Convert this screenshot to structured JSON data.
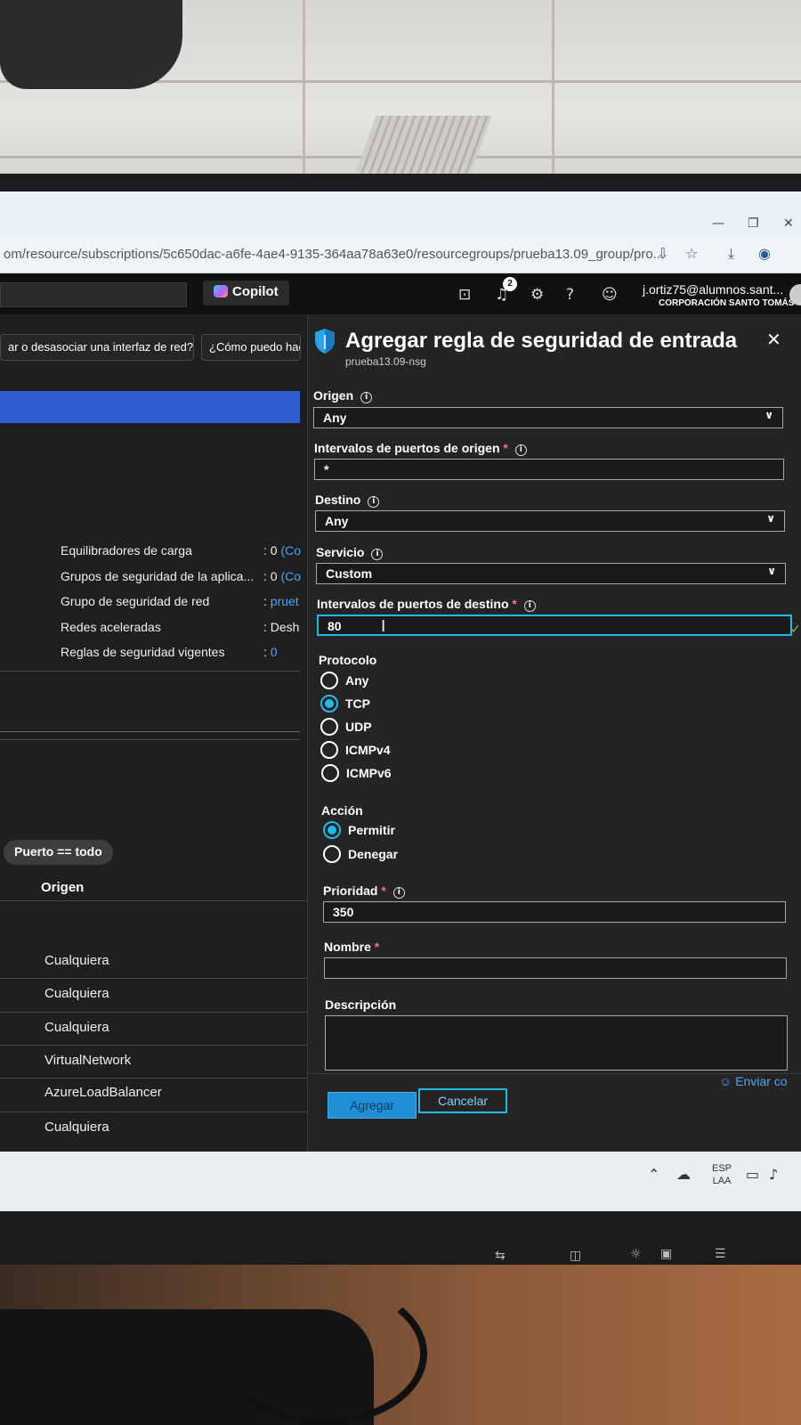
{
  "browser": {
    "url": "om/resource/subscriptions/5c650dac-a6fe-4ae4-9135-364aa78a63e0/resourcegroups/prueba13.09_group/pro...",
    "minimize": "—",
    "restore": "❐",
    "close": "✕"
  },
  "portal": {
    "copilot_label": "Copilot",
    "notifications_count": "2",
    "user_email": "j.ortiz75@alumnos.sant...",
    "user_org": "CORPORACIÓN SANTO TOMÁS"
  },
  "left": {
    "pill1": "ar o desasociar una interfaz de red?",
    "pill2": "¿Cómo puedo hac",
    "properties": [
      {
        "label": "Equilibradores de carga",
        "value": ": 0 ",
        "link": "(Co"
      },
      {
        "label": "Grupos de seguridad de la aplica...",
        "value": ": 0 ",
        "link": "(Co"
      },
      {
        "label": "Grupo de seguridad de red",
        "value": ": ",
        "link": "pruet"
      },
      {
        "label": "Redes aceleradas",
        "value": ": Desh",
        "link": ""
      },
      {
        "label": "Reglas de seguridad vigentes",
        "value": ": ",
        "link": "0"
      }
    ],
    "filter_chip": "Puerto == todo",
    "column_header": "Origen",
    "rows": [
      "Cualquiera",
      "Cualquiera",
      "Cualquiera",
      "VirtualNetwork",
      "AzureLoadBalancer",
      "Cualquiera"
    ]
  },
  "blade": {
    "title": "Agregar regla de seguridad de entrada",
    "subtitle": "prueba13.09-nsg",
    "origen_label": "Origen",
    "origen_value": "Any",
    "src_ports_label": "Intervalos de puertos de origen",
    "src_ports_value": "*",
    "destino_label": "Destino",
    "destino_value": "Any",
    "servicio_label": "Servicio",
    "servicio_value": "Custom",
    "dst_ports_label": "Intervalos de puertos de destino",
    "dst_ports_value": "80",
    "protocolo_label": "Protocolo",
    "protocols": [
      {
        "label": "Any",
        "selected": false
      },
      {
        "label": "TCP",
        "selected": true
      },
      {
        "label": "UDP",
        "selected": false
      },
      {
        "label": "ICMPv4",
        "selected": false
      },
      {
        "label": "ICMPv6",
        "selected": false
      }
    ],
    "accion_label": "Acción",
    "actions": [
      {
        "label": "Permitir",
        "selected": true
      },
      {
        "label": "Denegar",
        "selected": false
      }
    ],
    "prioridad_label": "Prioridad",
    "prioridad_value": "350",
    "nombre_label": "Nombre",
    "nombre_value": "",
    "descripcion_label": "Descripción",
    "descripcion_value": "",
    "required_mark": "*",
    "info_glyph": "i",
    "add_button": "Agregar",
    "cancel_button": "Cancelar",
    "feedback_link": "Enviar co"
  },
  "taskbar": {
    "lang_line1": "ESP",
    "lang_line2": "LAA"
  },
  "colors": {
    "accent": "#1fb9ee",
    "link": "#4aa3ff",
    "required": "#f1707b",
    "blade_bg": "#252423",
    "highlight_bar": "#2f5fce"
  },
  "icons": [
    "cloud-shell-icon",
    "notifications-icon",
    "settings-icon",
    "help-icon",
    "feedback-icon",
    "shield-icon",
    "close-icon",
    "chevron-down-icon",
    "info-icon",
    "checkmark-icon"
  ]
}
